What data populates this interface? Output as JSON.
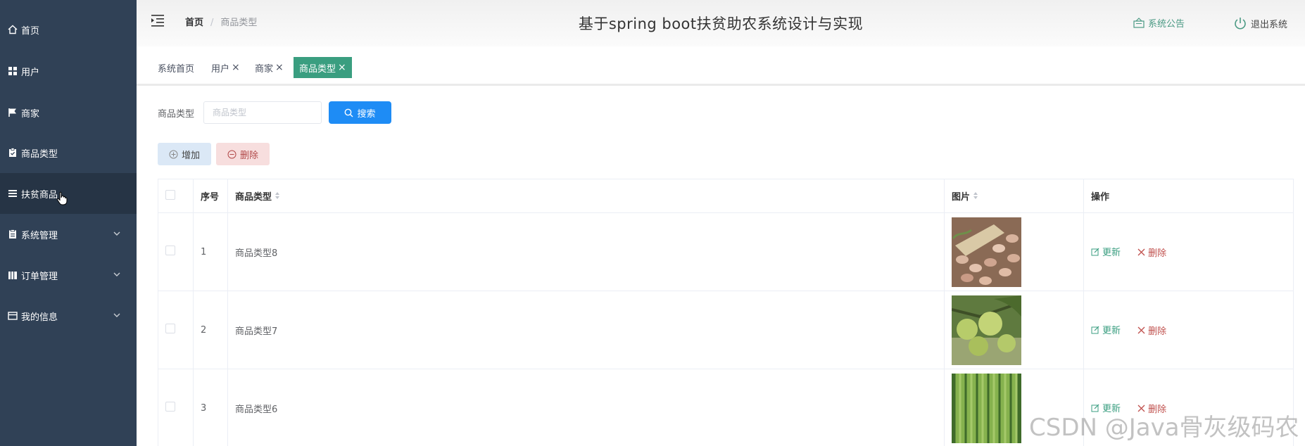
{
  "header": {
    "site_title": "基于spring boot扶贫助农系统设计与实现",
    "breadcrumb_home": "首页",
    "breadcrumb_current": "商品类型",
    "notice_label": "系统公告",
    "logout_label": "退出系统"
  },
  "sidebar": {
    "items": [
      {
        "label": "首页",
        "icon": "home-icon"
      },
      {
        "label": "用户",
        "icon": "grid-icon"
      },
      {
        "label": "商家",
        "icon": "flag-icon"
      },
      {
        "label": "商品类型",
        "icon": "clipboard-icon"
      },
      {
        "label": "扶贫商品",
        "icon": "list-icon"
      },
      {
        "label": "系统管理",
        "icon": "document-icon"
      },
      {
        "label": "订单管理",
        "icon": "book-icon"
      },
      {
        "label": "我的信息",
        "icon": "wallet-icon"
      }
    ]
  },
  "tags": [
    {
      "label": "系统首页"
    },
    {
      "label": "用户"
    },
    {
      "label": "商家"
    },
    {
      "label": "商品类型"
    }
  ],
  "search": {
    "label": "商品类型",
    "placeholder": "商品类型",
    "button_label": "搜索"
  },
  "actions": {
    "add_label": "增加",
    "delete_label": "删除"
  },
  "table": {
    "headers": {
      "index": "序号",
      "type": "商品类型",
      "image": "图片",
      "ops": "操作"
    },
    "rows": [
      {
        "index": "1",
        "type": "商品类型8",
        "update": "更新",
        "delete": "删除"
      },
      {
        "index": "2",
        "type": "商品类型7",
        "update": "更新",
        "delete": "删除"
      },
      {
        "index": "3",
        "type": "商品类型6",
        "update": "更新",
        "delete": "删除"
      }
    ]
  },
  "watermark": "CSDN @Java骨灰级码农",
  "colors": {
    "sidebar_bg": "#304156",
    "accent_green": "#3a9e80",
    "search_blue": "#1e8cf5",
    "delete_red": "#c0504d"
  }
}
